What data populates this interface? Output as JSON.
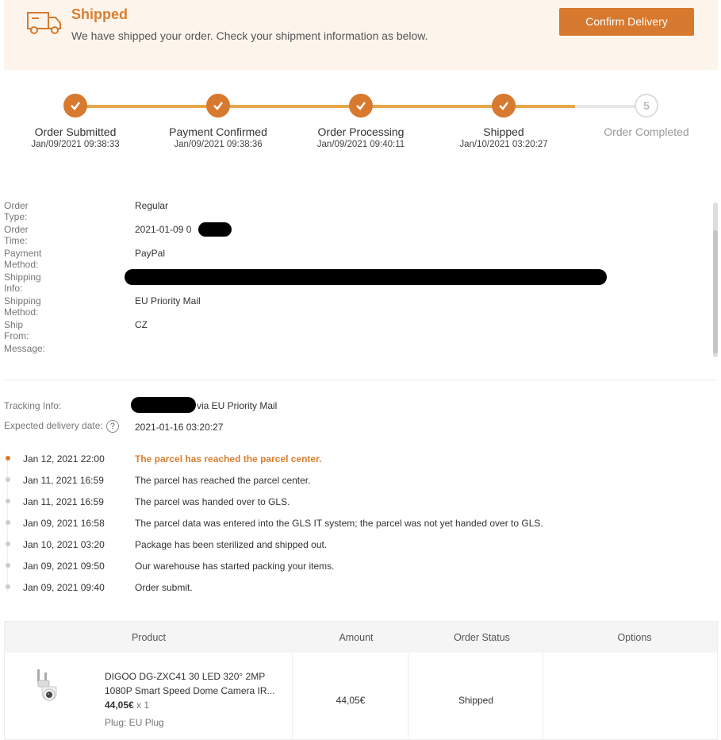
{
  "banner": {
    "icon": "truck-icon",
    "title": "Shipped",
    "subtitle": "We have shipped your order. Check your shipment information as below.",
    "confirm_label": "Confirm Delivery",
    "accent": "#d7792e",
    "background": "#fdf5ec"
  },
  "progress": {
    "steps": [
      {
        "label": "Order Submitted",
        "time": "Jan/09/2021 09:38:33",
        "done": true
      },
      {
        "label": "Payment Confirmed",
        "time": "Jan/09/2021 09:38:36",
        "done": true
      },
      {
        "label": "Order Processing",
        "time": "Jan/09/2021 09:40:11",
        "done": true
      },
      {
        "label": "Shipped",
        "time": "Jan/10/2021 03:20:27",
        "done": true
      },
      {
        "label": "Order Completed",
        "time": "",
        "done": false,
        "number": "5"
      }
    ]
  },
  "order_info": {
    "rows": [
      {
        "key": "Order Type:",
        "value": "Regular"
      },
      {
        "key": "Order Time:",
        "value": "2021-01-09 0"
      },
      {
        "key": "Payment Method:",
        "value": "PayPal"
      },
      {
        "key": "Shipping Info:",
        "value": ""
      },
      {
        "key": "Shipping Method:",
        "value": "EU Priority Mail"
      },
      {
        "key": "Ship From:",
        "value": "CZ"
      },
      {
        "key": "Message:",
        "value": ""
      }
    ]
  },
  "tracking": {
    "info_label": "Tracking Info:",
    "info_value": "via EU Priority Mail",
    "expected_label": "Expected delivery date:",
    "expected_value": "2021-01-16 03:20:27",
    "events": [
      {
        "date": "Jan 12, 2021 22:00",
        "text": "The parcel has reached the parcel center.",
        "active": true
      },
      {
        "date": "Jan 11, 2021 16:59",
        "text": "The parcel has reached the parcel center.",
        "active": false
      },
      {
        "date": "Jan 11, 2021 16:59",
        "text": "The parcel was handed over to GLS.",
        "active": false
      },
      {
        "date": "Jan 09, 2021 16:58",
        "text": "The parcel data was entered into the GLS IT system; the parcel was not yet handed over to GLS.",
        "active": false
      },
      {
        "date": "Jan 10, 2021 03:20",
        "text": "Package has been sterilized and shipped out.",
        "active": false
      },
      {
        "date": "Jan 09, 2021 09:50",
        "text": "Our warehouse has started packing your items.",
        "active": false
      },
      {
        "date": "Jan 09, 2021 09:40",
        "text": "Order submit.",
        "active": false
      }
    ]
  },
  "table": {
    "headers": {
      "product": "Product",
      "amount": "Amount",
      "status": "Order Status",
      "options": "Options"
    },
    "item": {
      "name_line1": "DIGOO DG-ZXC41 30 LED 320° 2MP",
      "name_line2": "1080P Smart Speed Dome Camera IR...",
      "price": "44,05€",
      "qty": "x 1",
      "variant": "Plug: EU Plug",
      "amount": "44,05€",
      "status": "Shipped"
    }
  }
}
